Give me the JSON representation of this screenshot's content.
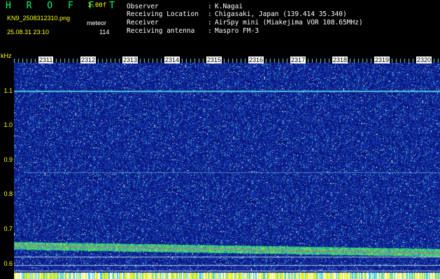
{
  "header": {
    "app_title": "H R O F F T",
    "version": "1.00f",
    "file_name": "KN9_2508312310.png",
    "mode": "meteor",
    "datetime": "25.08.31 23:10",
    "count": "114"
  },
  "meta": [
    {
      "label": "Observer",
      "value": "K.Nagai"
    },
    {
      "label": "Receiving Location",
      "value": "Chigasaki, Japan (139.414 35.340)"
    },
    {
      "label": "Receiver",
      "value": "AirSpy mini (Miakejima VOR 108.65MHz)"
    },
    {
      "label": "Receiving antenna",
      "value": "Maspro FM-3"
    }
  ],
  "axis": {
    "y_unit": "kHz",
    "y_ticks": [
      "1.1",
      "1.0",
      "0.9",
      "0.8",
      "0.7",
      "0.6"
    ],
    "x_ticks": [
      "2311",
      "2312",
      "2313",
      "2314",
      "2315",
      "2316",
      "2317",
      "2318",
      "2319",
      "2320"
    ]
  },
  "colors": {
    "background": "#000000",
    "noise_base": "#1a2fa8",
    "header_yellow": "#ffff00",
    "title_green": "#00ff66"
  }
}
